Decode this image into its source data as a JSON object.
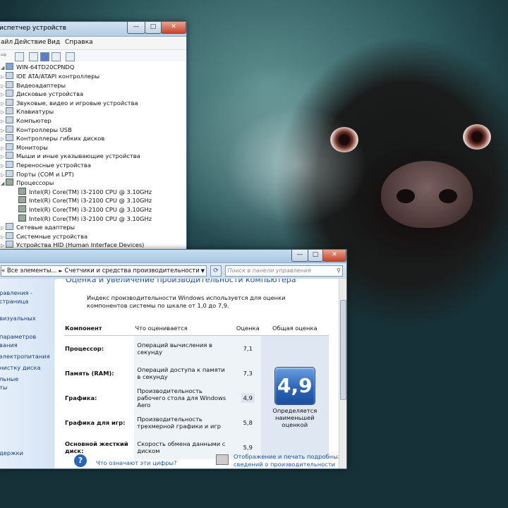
{
  "device_manager": {
    "title": "испетчер устройств",
    "menu": [
      "айл",
      "Действие",
      "Вид",
      "Справка"
    ],
    "root": "WIN-64TD20CPNDQ",
    "nodes": [
      {
        "label": "IDE ATA/ATAPI контроллеры",
        "icon": "ide-controller-icon"
      },
      {
        "label": "Видеоадаптеры",
        "icon": "display-adapter-icon"
      },
      {
        "label": "Дисковые устройства",
        "icon": "disk-drive-icon"
      },
      {
        "label": "Звуковые, видео и игровые устройства",
        "icon": "sound-device-icon"
      },
      {
        "label": "Клавиатуры",
        "icon": "keyboard-icon"
      },
      {
        "label": "Компьютер",
        "icon": "computer-icon"
      },
      {
        "label": "Контроллеры USB",
        "icon": "usb-controller-icon"
      },
      {
        "label": "Контроллеры гибких дисков",
        "icon": "floppy-controller-icon"
      },
      {
        "label": "Мониторы",
        "icon": "monitor-icon"
      },
      {
        "label": "Мыши и иные указывающие устройства",
        "icon": "mouse-icon"
      },
      {
        "label": "Переносные устройства",
        "icon": "portable-device-icon"
      },
      {
        "label": "Порты (COM и LPT)",
        "icon": "port-icon"
      },
      {
        "label": "Процессоры",
        "icon": "processor-icon"
      }
    ],
    "cpus": [
      "Intel(R) Core(TM) i3-2100 CPU @ 3.10GHz",
      "Intel(R) Core(TM) i3-2100 CPU @ 3.10GHz",
      "Intel(R) Core(TM) i3-2100 CPU @ 3.10GHz",
      "Intel(R) Core(TM) i3-2100 CPU @ 3.10GHz"
    ],
    "after": [
      {
        "label": "Сетевые адаптеры",
        "icon": "network-adapter-icon"
      },
      {
        "label": "Системные устройства",
        "icon": "system-device-icon"
      },
      {
        "label": "Устройства HID (Human Interface Devices)",
        "icon": "hid-device-icon"
      }
    ]
  },
  "control_panel": {
    "breadcrumb_prefix": "«",
    "breadcrumb_1": "Все элементы...",
    "breadcrumb_sep": "►",
    "breadcrumb_2": "Счетчики и средства производительности",
    "search_placeholder": "Поиск в панели управления",
    "left_links": [
      "равления -",
      "страница",
      "визуальных",
      "параметров",
      "вания",
      "электропитания",
      "нистку диска",
      "льные",
      "ты",
      "держки"
    ],
    "heading": "Оценка и увеличение производительности компьютера",
    "intro": "Индекс производительности Windows используется для оценки компонентов системы по шкале от 1,0 до 7,9.",
    "headers": {
      "component": "Компонент",
      "what": "Что оценивается",
      "score": "Оценка",
      "overall": "Общая оценка"
    },
    "rows": [
      {
        "component": "Процессор:",
        "what": "Операций вычисления в секунду",
        "score": "7,1"
      },
      {
        "component": "Память (RAM):",
        "what": "Операций доступа к памяти в секунду",
        "score": "7,3"
      },
      {
        "component": "Графика:",
        "what": "Производительность рабочего стола для Windows Aero",
        "score": "4,9"
      },
      {
        "component": "Графика для игр:",
        "what": "Производительность трехмерной графики и игр",
        "score": "5,8"
      },
      {
        "component": "Основной жесткий диск:",
        "what": "Скорость обмена данными с диском",
        "score": "5,9"
      }
    ],
    "overall_score": "4,9",
    "overall_text": "Определяется наименьшей оценкой",
    "help_link": "Что означают эти цифры?",
    "print_link_1": "Отображение и печать подробных",
    "print_link_2": "сведений о производительности"
  }
}
